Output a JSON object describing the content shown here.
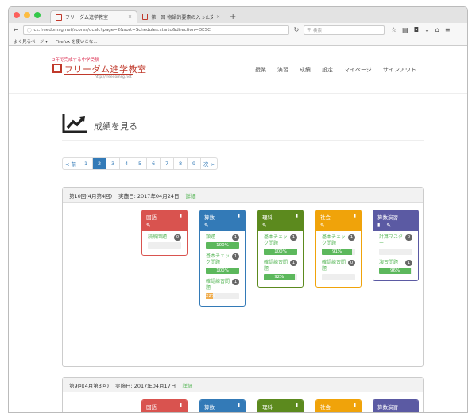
{
  "browser": {
    "tabs": [
      {
        "title": "フリーダム進学教室"
      },
      {
        "title": "第一回 物語的要素の入った文章"
      }
    ],
    "url": "ck.freedomsg.net/scores/ucalc?page=2&sort=Schedules.startd&direction=DESC",
    "search_placeholder": "検索",
    "bookmarks": [
      "よく見るページ ▾",
      "Firefox を使いこな..."
    ]
  },
  "site": {
    "tagline": "2年で完成する中学受験",
    "name": "フリーダム進学教室",
    "url_text": "http://freedomsg.net",
    "menu": [
      "授業",
      "演習",
      "成績",
      "設定",
      "マイページ",
      "サインアウト"
    ]
  },
  "page": {
    "title": "成績を見る"
  },
  "pagination": {
    "items": [
      "< 前",
      "1",
      "2",
      "3",
      "4",
      "5",
      "6",
      "7",
      "8",
      "9",
      "次 >"
    ],
    "current": "2"
  },
  "panels": [
    {
      "round": "第10回(4月第4回)",
      "date": "実施日: 2017年04月24日",
      "detail": "詳細",
      "subjects": [
        {
          "name": "国語",
          "color": "#d9534f",
          "items": [
            {
              "name": "読解問題",
              "badge": "0",
              "progress": null
            }
          ]
        },
        {
          "name": "算数",
          "color": "#337ab7",
          "items": [
            {
              "name": "類題",
              "badge": "1",
              "progress": 100,
              "label": "100%",
              "bar": "#5cb85c"
            },
            {
              "name": "基本チェック問題",
              "badge": "1",
              "progress": 100,
              "label": "100%",
              "bar": "#5cb85c"
            },
            {
              "name": "確認練習問題",
              "badge": "1",
              "progress": 22,
              "label": "22%",
              "bar": "#f0ad4e"
            }
          ]
        },
        {
          "name": "理科",
          "color": "#5c8a1e",
          "items": [
            {
              "name": "基本チェック問題",
              "badge": "1",
              "progress": 100,
              "label": "100%",
              "bar": "#5cb85c"
            },
            {
              "name": "確認練習問題",
              "badge": "1",
              "progress": 92,
              "label": "92%",
              "bar": "#5cb85c"
            }
          ]
        },
        {
          "name": "社会",
          "color": "#f0a30a",
          "items": [
            {
              "name": "基本チェック問題",
              "badge": "1",
              "progress": 91,
              "label": "91%",
              "bar": "#5cb85c"
            },
            {
              "name": "確認練習問題",
              "badge": "0",
              "progress": null
            }
          ]
        },
        {
          "name": "算数演習",
          "color": "#5b5aa3",
          "items": [
            {
              "name": "計算マスター",
              "badge": "0",
              "progress": null
            },
            {
              "name": "演習問題",
              "badge": "1",
              "progress": 96,
              "label": "96%",
              "bar": "#5cb85c"
            }
          ]
        }
      ]
    },
    {
      "round": "第9回(4月第3回)",
      "date": "実施日: 2017年04月17日",
      "detail": "詳細",
      "subjects": [
        {
          "name": "国語",
          "color": "#d9534f",
          "items": []
        },
        {
          "name": "算数",
          "color": "#337ab7",
          "items": []
        },
        {
          "name": "理科",
          "color": "#5c8a1e",
          "items": []
        },
        {
          "name": "社会",
          "color": "#f0a30a",
          "items": []
        },
        {
          "name": "算数演習",
          "color": "#5b5aa3",
          "items": []
        }
      ]
    }
  ]
}
